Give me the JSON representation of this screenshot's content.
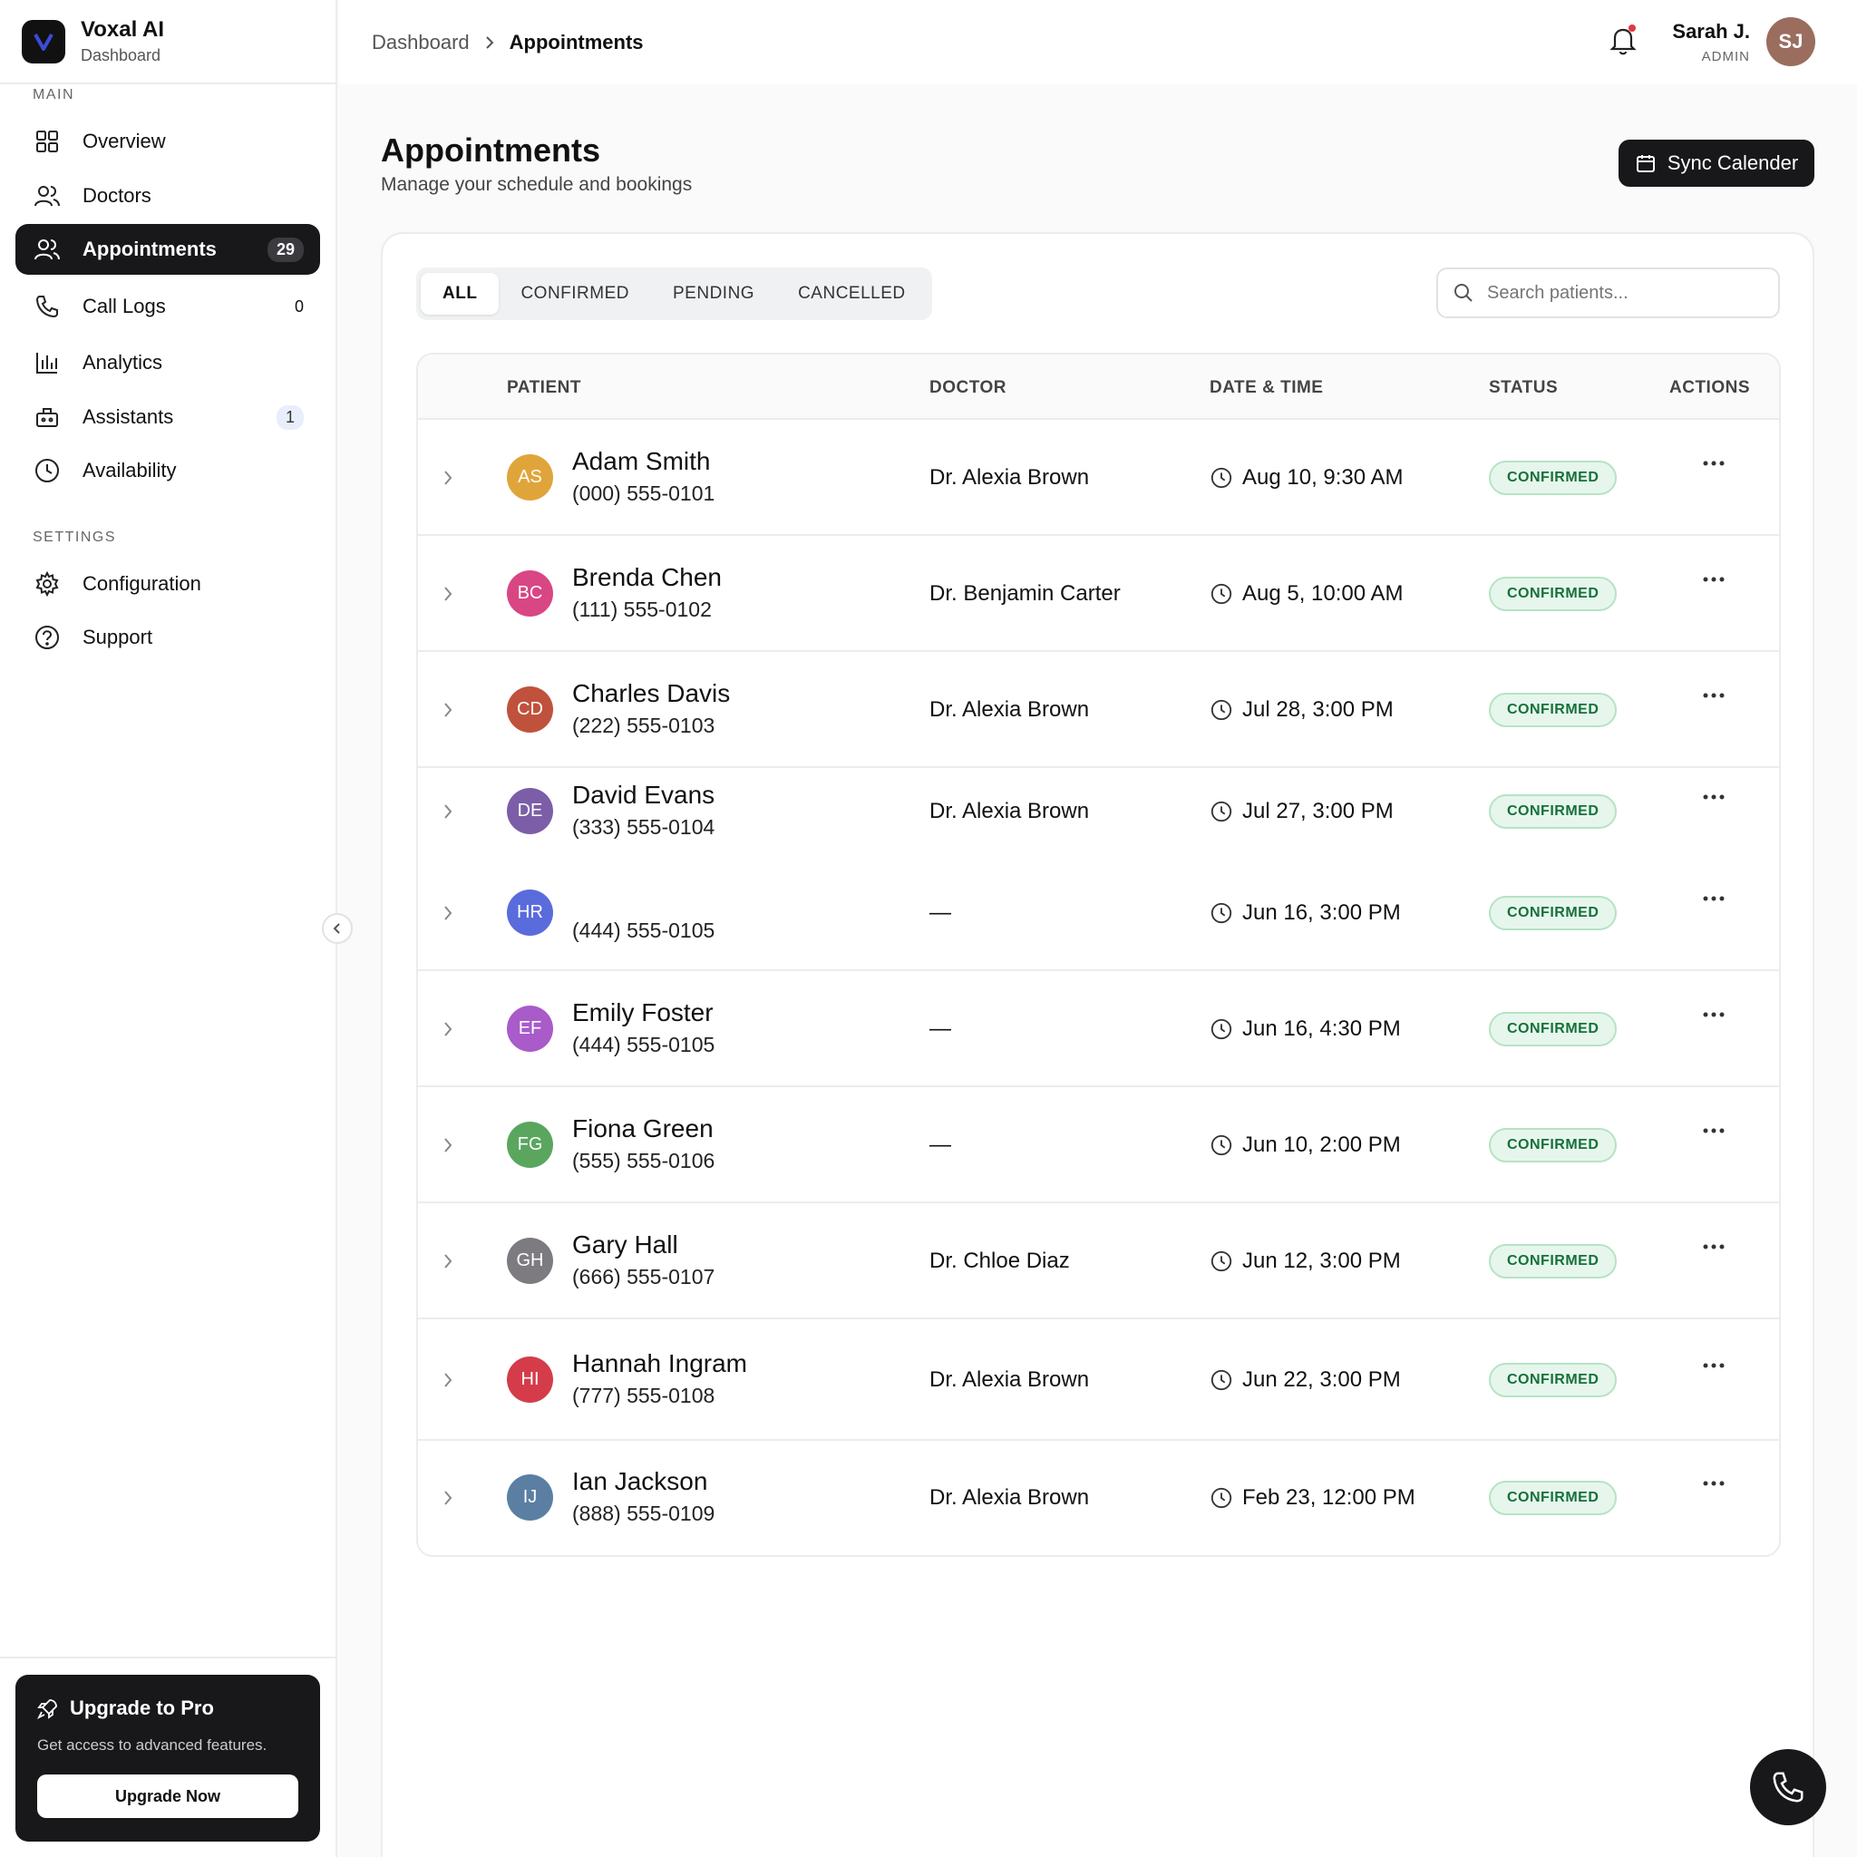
{
  "brand": {
    "name": "Voxal AI",
    "subtitle": "Dashboard"
  },
  "sidebar": {
    "main_label": "MAIN",
    "settings_label": "SETTINGS",
    "items": [
      {
        "label": "Overview",
        "icon": "grid-icon",
        "badge": ""
      },
      {
        "label": "Doctors",
        "icon": "users-icon",
        "badge": ""
      },
      {
        "label": "Appointments",
        "icon": "users-icon",
        "badge": "29",
        "active": true
      },
      {
        "label": "Call Logs",
        "icon": "phone-icon",
        "badge": "0"
      },
      {
        "label": "Analytics",
        "icon": "bar-chart-icon",
        "badge": ""
      },
      {
        "label": "Assistants",
        "icon": "bot-icon",
        "badge": "1"
      },
      {
        "label": "Availability",
        "icon": "clock-icon",
        "badge": ""
      }
    ],
    "settings_items": [
      {
        "label": "Configuration",
        "icon": "gear-icon"
      },
      {
        "label": "Support",
        "icon": "help-icon"
      }
    ],
    "upgrade": {
      "title": "Upgrade to Pro",
      "text": "Get access to advanced features.",
      "button": "Upgrade Now"
    }
  },
  "header": {
    "breadcrumb": [
      "Dashboard",
      "Appointments"
    ],
    "user": {
      "name": "Sarah J.",
      "role": "ADMIN",
      "initials": "SJ"
    }
  },
  "main": {
    "title": "Appointments",
    "subtitle": "Manage your schedule and bookings",
    "sync_label": "Sync Calender",
    "tabs": [
      "ALL",
      "CONFIRMED",
      "PENDING",
      "CANCELLED"
    ],
    "search_placeholder": "Search patients...",
    "columns": [
      "PATIENT",
      "DOCTOR",
      "DATE & TIME",
      "STATUS",
      "ACTIONS"
    ],
    "rows": [
      {
        "initials": "AS",
        "name": "Adam Smith",
        "phone": "(000) 555-0101",
        "doctor": "Dr. Alexia Brown",
        "datetime": "Aug 10, 9:30 AM",
        "status": "CONFIRMED",
        "color": "#e0a53a"
      },
      {
        "initials": "BC",
        "name": "Brenda Chen",
        "phone": "(111) 555-0102",
        "doctor": "Dr. Benjamin Carter",
        "datetime": "Aug 5, 10:00 AM",
        "status": "CONFIRMED",
        "color": "#d94684"
      },
      {
        "initials": "CD",
        "name": "Charles Davis",
        "phone": "(222) 555-0103",
        "doctor": "Dr. Alexia Brown",
        "datetime": "Jul 28, 3:00 PM",
        "status": "CONFIRMED",
        "color": "#c0523d"
      },
      {
        "initials": "DE",
        "name": "David Evans",
        "phone": "(333) 555-0104",
        "doctor": "Dr. Alexia Brown",
        "datetime": "Jul 27, 3:00 PM",
        "status": "CONFIRMED",
        "color": "#7b5ea7"
      },
      {
        "initials": "HR",
        "name": "",
        "phone": "(444) 555-0105",
        "doctor": "—",
        "datetime": "Jun 16, 3:00 PM",
        "status": "CONFIRMED",
        "color": "#5a6bdc"
      },
      {
        "initials": "EF",
        "name": "Emily Foster",
        "phone": "(444) 555-0105",
        "doctor": "—",
        "datetime": "Jun 16, 4:30 PM",
        "status": "CONFIRMED",
        "color": "#a85bc9"
      },
      {
        "initials": "FG",
        "name": "Fiona Green",
        "phone": "(555) 555-0106",
        "doctor": "—",
        "datetime": "Jun 10, 2:00 PM",
        "status": "CONFIRMED",
        "color": "#5aa65f"
      },
      {
        "initials": "GH",
        "name": "Gary Hall",
        "phone": "(666) 555-0107",
        "doctor": "Dr. Chloe Diaz",
        "datetime": "Jun 12, 3:00 PM",
        "status": "CONFIRMED",
        "color": "#7d7a80"
      },
      {
        "initials": "HI",
        "name": "Hannah Ingram",
        "phone": "(777) 555-0108",
        "doctor": "Dr. Alexia Brown",
        "datetime": "Jun 22, 3:00 PM",
        "status": "CONFIRMED",
        "color": "#d43c4a"
      },
      {
        "initials": "IJ",
        "name": "Ian Jackson",
        "phone": "(888) 555-0109",
        "doctor": "Dr. Alexia Brown",
        "datetime": "Feb 23, 12:00 PM",
        "status": "CONFIRMED",
        "color": "#5b7fa3"
      }
    ]
  }
}
